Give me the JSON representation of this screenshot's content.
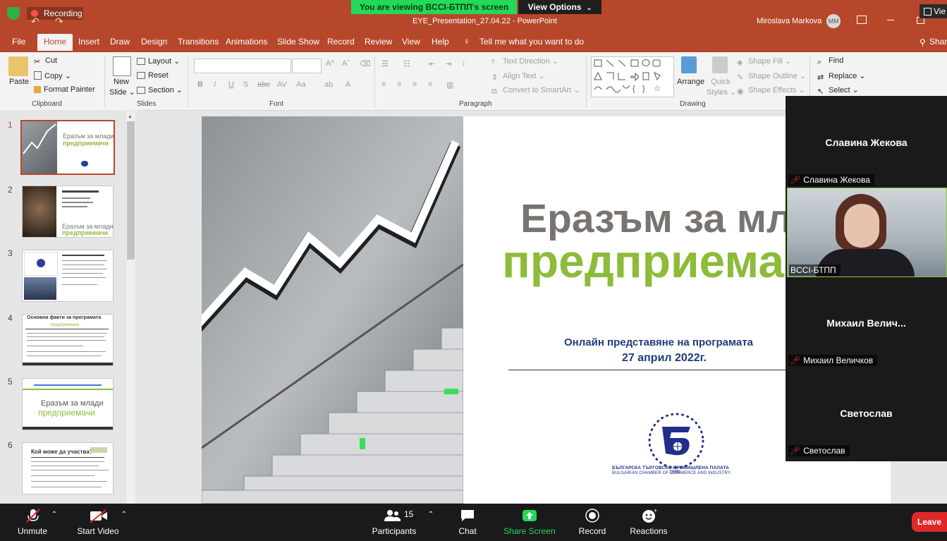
{
  "zoom": {
    "recording_label": "Recording",
    "banner_text": "You are viewing BCCI-БТПП's screen",
    "view_options_label": "View Options",
    "toolbar": {
      "unmute_label": "Unmute",
      "start_video_label": "Start Video",
      "participants_label": "Participants",
      "participants_count": "15",
      "chat_label": "Chat",
      "share_screen_label": "Share Screen",
      "record_label": "Record",
      "reactions_label": "Reactions",
      "leave_label": "Leave"
    },
    "video_tiles": [
      {
        "name": "Славина Жекова",
        "label": "Славина Жекова"
      },
      {
        "name": "",
        "label": "BCCI-БТПП"
      },
      {
        "name": "Михаил  Велич...",
        "label": "Михаил Величков"
      },
      {
        "name": "Светослав",
        "label": "Светослав"
      }
    ],
    "corner_view_label": "Vie"
  },
  "window": {
    "title": "EYE_Presentation_27.04.22  -  PowerPoint",
    "user_name": "Miroslava Markova",
    "user_initials": "MM"
  },
  "ribbon_tabs": [
    "File",
    "Home",
    "Insert",
    "Draw",
    "Design",
    "Transitions",
    "Animations",
    "Slide Show",
    "Record",
    "Review",
    "View",
    "Help"
  ],
  "tell_me": "Tell me what you want to do",
  "share_label": "Share",
  "ribbon": {
    "clipboard": {
      "paste": "Paste",
      "cut": "Cut",
      "copy": "Copy",
      "format_painter": "Format Painter",
      "label": "Clipboard"
    },
    "slides": {
      "new_slide": "New",
      "new_slide2": "Slide",
      "layout": "Layout",
      "reset": "Reset",
      "section": "Section",
      "label": "Slides"
    },
    "font": {
      "label": "Font"
    },
    "paragraph": {
      "text_direction": "Text Direction",
      "align_text": "Align Text",
      "convert_smartart": "Convert to SmartArt",
      "label": "Paragraph"
    },
    "drawing": {
      "arrange": "Arrange",
      "quick": "Quick",
      "styles": "Styles",
      "shape_fill": "Shape Fill",
      "shape_outline": "Shape Outline",
      "shape_effects": "Shape Effects",
      "label": "Drawing"
    },
    "editing": {
      "find": "Find",
      "replace": "Replace",
      "select": "Select"
    }
  },
  "thumbnails": [
    {
      "num": "1",
      "t1": "Еразъм за млади",
      "t2": "предприемачи"
    },
    {
      "num": "2",
      "t1": "Еразъм за млади",
      "t2": "предприемачи"
    },
    {
      "num": "3",
      "t1": "",
      "t2": ""
    },
    {
      "num": "4",
      "t1": "Основни факти за програмата",
      "t2": "предприемачи"
    },
    {
      "num": "5",
      "t1": "Еразъм за млади",
      "t2": "предприемачи"
    },
    {
      "num": "6",
      "t1": "Кой може да участва?",
      "t2": ""
    }
  ],
  "slide": {
    "title_line1": "Еразъм за мла",
    "title_line2": "предприема",
    "subtitle_line1": "Онлайн представяне на програмата",
    "subtitle_line2": "27 април 2022г.",
    "logo_year": "1895",
    "logo_text_bg": "БЪЛГАРСКА ТЪРГОВСКО-ПРОМИШЛЕНА ПАЛАТА",
    "logo_text_en": "BULGARIAN CHAMBER OF COMMERCE AND INDUSTRY"
  },
  "colors": {
    "ppt_accent": "#b7472a",
    "title_gray": "#7a7470",
    "title_green": "#8dbb3a",
    "subtitle_blue": "#1f3b7a",
    "zoom_green": "#23d959"
  }
}
